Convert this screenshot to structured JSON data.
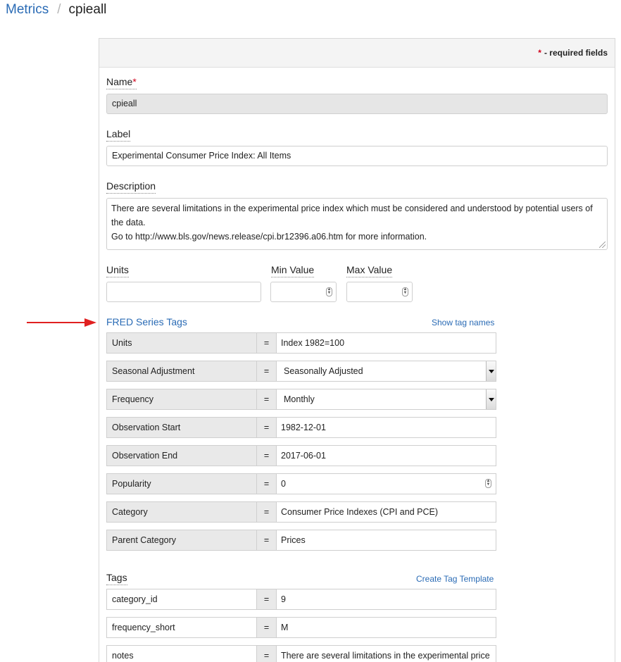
{
  "breadcrumb": {
    "root": "Metrics",
    "separator": "/",
    "current": "cpieall"
  },
  "header": {
    "required_note": "- required fields",
    "required_star": "*"
  },
  "name": {
    "label": "Name",
    "star": "*",
    "value": "cpieall"
  },
  "label_field": {
    "label": "Label",
    "value": "Experimental Consumer Price Index: All Items"
  },
  "description": {
    "label": "Description",
    "line1": "There are several limitations in the experimental price index which must be considered and understood by potential users of",
    "line2": "the data.",
    "line3": "Go to http://www.bls.gov/news.release/cpi.br12396.a06.htm for more information."
  },
  "units": {
    "label": "Units",
    "value": ""
  },
  "min_value": {
    "label": "Min Value",
    "value": ""
  },
  "max_value": {
    "label": "Max Value",
    "value": ""
  },
  "fred": {
    "title": "FRED Series Tags",
    "show_link": "Show tag names",
    "rows": [
      {
        "key": "Units",
        "eq": "=",
        "value": "Index 1982=100"
      },
      {
        "key": "Seasonal Adjustment",
        "eq": "=",
        "value": "Seasonally Adjusted"
      },
      {
        "key": "Frequency",
        "eq": "=",
        "value": "Monthly"
      },
      {
        "key": "Observation Start",
        "eq": "=",
        "value": "1982-12-01"
      },
      {
        "key": "Observation End",
        "eq": "=",
        "value": "2017-06-01"
      },
      {
        "key": "Popularity",
        "eq": "=",
        "value": "0"
      },
      {
        "key": "Category",
        "eq": "=",
        "value": "Consumer Price Indexes (CPI and PCE)"
      },
      {
        "key": "Parent Category",
        "eq": "=",
        "value": "Prices"
      }
    ]
  },
  "tags": {
    "title": "Tags",
    "create_link": "Create Tag Template",
    "rows": [
      {
        "key": "category_id",
        "eq": "=",
        "value": "9"
      },
      {
        "key": "frequency_short",
        "eq": "=",
        "value": "M"
      },
      {
        "key": "notes",
        "eq": "=",
        "value": "There are several limitations in the experimental price"
      }
    ]
  },
  "colors": {
    "link": "#2a6bb5",
    "required": "#d0021b",
    "arrow": "#e02020"
  }
}
